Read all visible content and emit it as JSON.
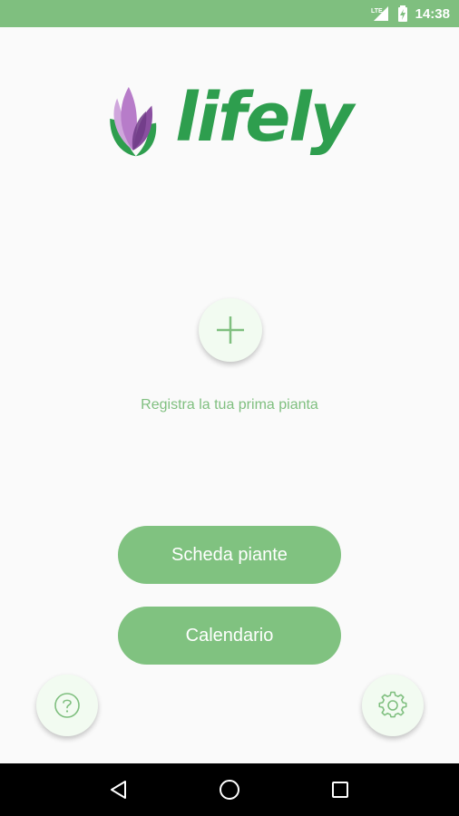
{
  "status_bar": {
    "network": "LTE",
    "time": "14:38",
    "icons": [
      "signal-icon",
      "battery-icon"
    ]
  },
  "logo": {
    "text": "lifely"
  },
  "empty_state": {
    "add_icon": "plus-icon",
    "label": "Registra la tua prima pianta"
  },
  "buttons": {
    "plants": "Scheda piante",
    "calendar": "Calendario",
    "help_icon": "help-icon",
    "settings_icon": "gear-icon"
  },
  "nav_bar": {
    "icons": [
      "back-icon",
      "home-icon",
      "recents-icon"
    ]
  },
  "colors": {
    "accent": "#7fbf7f",
    "logo_green": "#2e9e4e",
    "button_fill": "#80c280",
    "purple": "#8a4fa0"
  }
}
